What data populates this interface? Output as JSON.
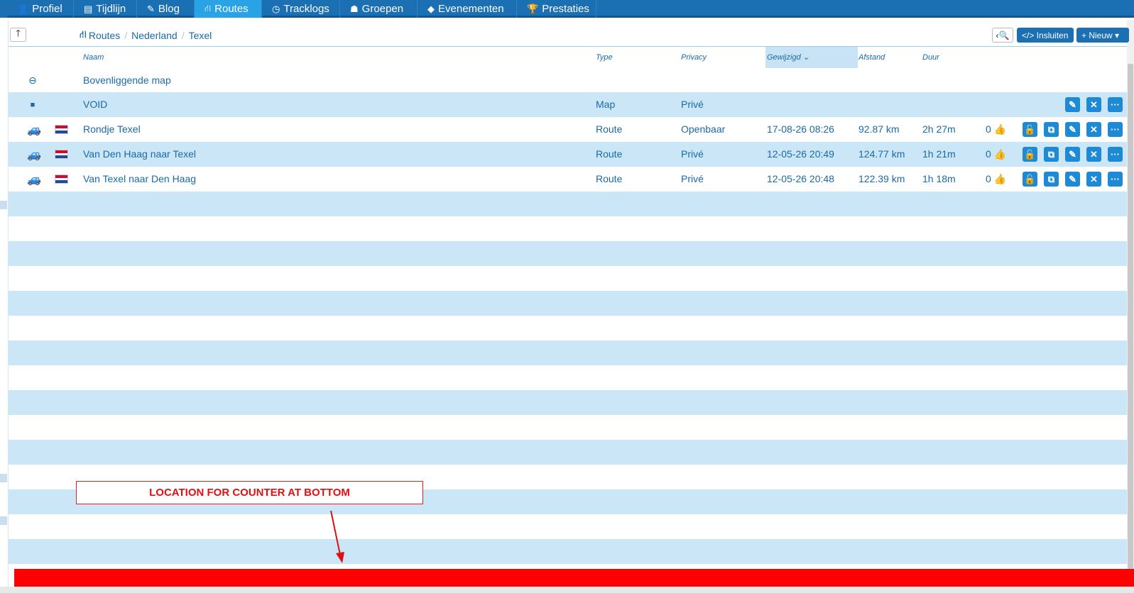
{
  "nav": {
    "items": [
      {
        "icon": "user-icon",
        "glyph": "👤",
        "label": "Profiel"
      },
      {
        "icon": "list-icon",
        "glyph": "▤",
        "label": "Tijdlijn"
      },
      {
        "icon": "pencil-icon",
        "glyph": "✎",
        "label": "Blog"
      },
      {
        "icon": "road-icon",
        "glyph": "⛙",
        "label": "Routes",
        "active": true
      },
      {
        "icon": "clock-icon",
        "glyph": "◷",
        "label": "Tracklogs"
      },
      {
        "icon": "group-icon",
        "glyph": "☗",
        "label": "Groepen"
      },
      {
        "icon": "ticket-icon",
        "glyph": "◆",
        "label": "Evenementen"
      },
      {
        "icon": "trophy-icon",
        "glyph": "🏆",
        "label": "Prestaties"
      }
    ]
  },
  "toolbar": {
    "up_glyph": "🡑",
    "breadcrumb": [
      "Routes",
      "Nederland",
      "Texel"
    ],
    "search_glyph": "‹🔍",
    "embed_label": "</> Insluiten",
    "new_label": "+ Nieuw ▾"
  },
  "table": {
    "headers": {
      "name": "Naam",
      "type": "Type",
      "privacy": "Privacy",
      "modified": "Gewijzigd ⌄",
      "distance": "Afstand",
      "duration": "Duur"
    },
    "parent_row": {
      "glyph": "⊖",
      "label": "Bovenliggende map"
    },
    "folder_row": {
      "glyph": "■",
      "name": "VOID",
      "type": "Map",
      "privacy": "Privé"
    },
    "routes": [
      {
        "name": "Rondje Texel",
        "type": "Route",
        "privacy": "Openbaar",
        "modified": "17-08-26 08:26",
        "distance": "92.87 km",
        "duration": "2h 27m",
        "likes": "0"
      },
      {
        "name": "Van Den Haag naar Texel",
        "type": "Route",
        "privacy": "Privé",
        "modified": "12-05-26 20:49",
        "distance": "124.77 km",
        "duration": "1h 21m",
        "likes": "0"
      },
      {
        "name": "Van Texel naar Den Haag",
        "type": "Route",
        "privacy": "Privé",
        "modified": "12-05-26 20:48",
        "distance": "122.39 km",
        "duration": "1h 18m",
        "likes": "0"
      }
    ]
  },
  "annotation": {
    "label": "LOCATION FOR COUNTER AT BOTTOM"
  },
  "colors": {
    "nav_bg": "#1b6fb3",
    "nav_active": "#2aa3e6",
    "row_alt": "#cbe6f7",
    "action_btn": "#1e8ad6",
    "annotation_red": "#ff0000"
  }
}
